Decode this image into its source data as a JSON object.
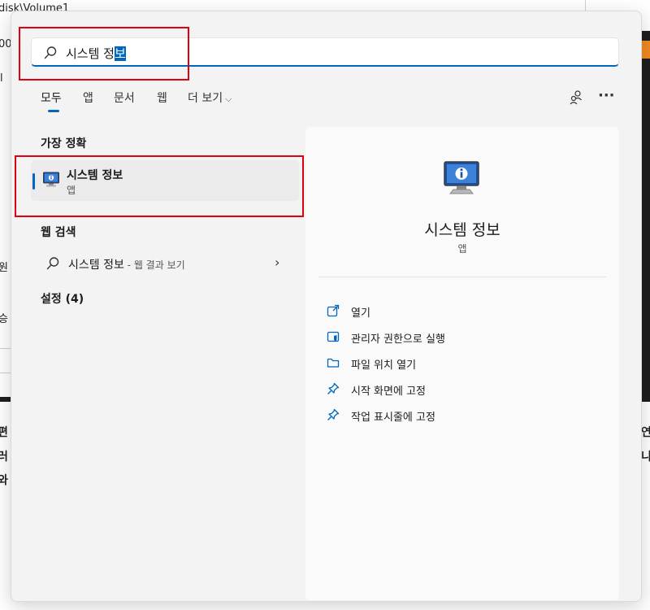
{
  "background": {
    "path_fragment": "disk\\Volume1",
    "left_fragments": [
      "00",
      "l",
      "원",
      "승"
    ],
    "bottom_left_lines": [
      "편",
      "러",
      "와"
    ],
    "bottom_right_lines": [
      "연",
      "니"
    ]
  },
  "search": {
    "query_prefix": "시스템 정",
    "query_selected": "보"
  },
  "tabs": [
    {
      "label": "모두",
      "active": true
    },
    {
      "label": "앱",
      "active": false
    },
    {
      "label": "문서",
      "active": false
    },
    {
      "label": "웹",
      "active": false
    },
    {
      "label": "더 보기",
      "active": false
    }
  ],
  "best_match": {
    "header": "가장 정확",
    "title": "시스템 정보",
    "subtitle": "앱"
  },
  "web_search": {
    "header": "웹 검색",
    "query": "시스템 정보",
    "suffix": " - 웹 결과 보기"
  },
  "settings": {
    "header": "설정 (4)"
  },
  "detail": {
    "title": "시스템 정보",
    "subtitle": "앱",
    "actions": [
      {
        "label": "열기",
        "icon": "open-icon"
      },
      {
        "label": "관리자 권한으로 실행",
        "icon": "shield-icon"
      },
      {
        "label": "파일 위치 열기",
        "icon": "folder-icon"
      },
      {
        "label": "시작 화면에 고정",
        "icon": "pin-icon"
      },
      {
        "label": "작업 표시줄에 고정",
        "icon": "pin-icon"
      }
    ]
  },
  "colors": {
    "accent": "#0067c0",
    "highlight_box": "#e0000f",
    "panel_bg": "#f3f3f3"
  }
}
